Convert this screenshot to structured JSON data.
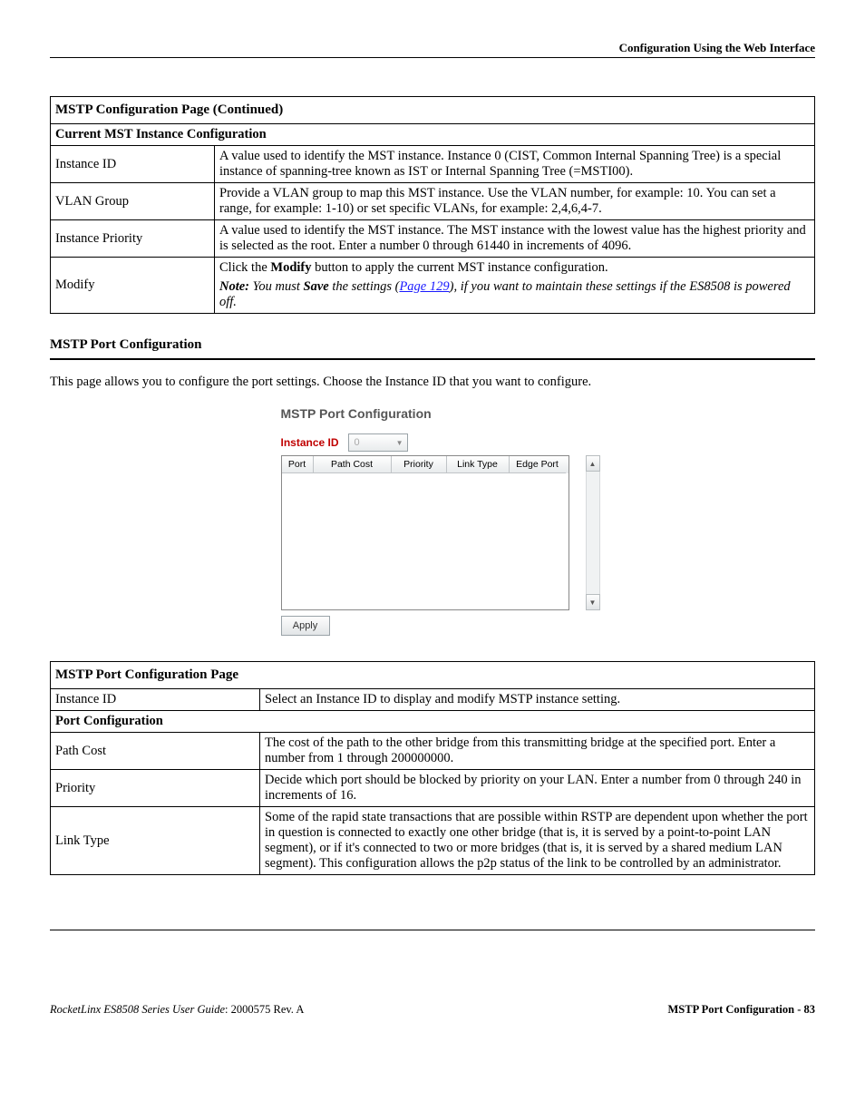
{
  "header": {
    "right": "Configuration Using the Web Interface"
  },
  "table1": {
    "title": "MSTP Configuration Page  (Continued)",
    "subtitle": "Current MST Instance Configuration",
    "rows": {
      "instance_id": {
        "label": "Instance ID",
        "desc": "A value used to identify the MST instance. Instance 0 (CIST, Common Internal Spanning Tree) is a special instance of spanning-tree known as IST or Internal Spanning Tree (=MSTI00)."
      },
      "vlan_group": {
        "label": "VLAN Group",
        "desc": "Provide a VLAN group to map this MST instance. Use the VLAN number, for example: 10. You can set a range, for example: 1-10) or set specific VLANs, for example: 2,4,6,4-7."
      },
      "instance_priority": {
        "label": "Instance Priority",
        "desc": "A value used to identify the MST instance. The MST instance with the lowest value has the highest priority and is selected as the root. Enter a number 0 through 61440 in increments of 4096."
      },
      "modify": {
        "label": "Modify",
        "click_pre": "Click the ",
        "click_bold": "Modify",
        "click_post": " button to apply the current MST instance configuration.",
        "note_label": "Note:",
        "note_pre": "  You must ",
        "note_save": "Save",
        "note_mid": " the settings (",
        "note_link": "Page 129",
        "note_post": "), if you want to maintain these settings if the ES8508 is powered off."
      }
    }
  },
  "section": {
    "heading": "MSTP Port Configuration",
    "intro": "This page allows you to configure the port settings. Choose the Instance ID that you want to configure."
  },
  "ui": {
    "title": "MSTP Port Configuration",
    "instance_label": "Instance ID",
    "dd_value": "0",
    "grid_headers": {
      "port": "Port",
      "path": "Path Cost",
      "prio": "Priority",
      "link": "Link Type",
      "edge": "Edge Port"
    },
    "apply": "Apply"
  },
  "table2": {
    "title": "MSTP Port Configuration Page",
    "instance_id": {
      "label": "Instance ID",
      "desc": "Select an Instance ID to display and modify MSTP instance setting."
    },
    "subtitle": "Port Configuration",
    "rows": {
      "path_cost": {
        "label": "Path Cost",
        "desc": "The cost of the path to the other bridge from this transmitting bridge at the specified port. Enter a number from 1 through 200000000."
      },
      "priority": {
        "label": "Priority",
        "desc": "Decide which port should be blocked by priority on your LAN. Enter a number from 0 through 240 in increments of 16."
      },
      "link_type": {
        "label": "Link Type",
        "desc": "Some of the rapid state transactions that are possible within RSTP are dependent upon whether the port in question is connected to exactly one other bridge (that is, it is served by a point-to-point LAN segment), or if it's connected to two or more bridges (that is, it is served by a shared medium LAN segment). This configuration allows the p2p status of the link to be controlled by an administrator."
      }
    }
  },
  "footer": {
    "left_italic": "RocketLinx ES8508 Series  User Guide",
    "left_rest": ": 2000575 Rev. A",
    "right": "MSTP Port Configuration - 83"
  }
}
